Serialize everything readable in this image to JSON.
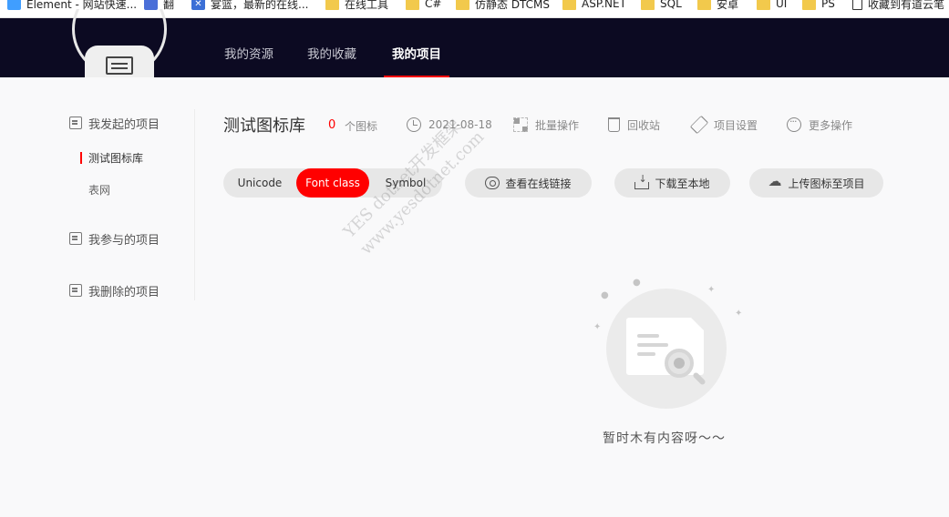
{
  "bookmarks": [
    {
      "label": "Element - 网站快速...",
      "icon": "element-icon"
    },
    {
      "label": "翻",
      "icon": "translate-icon"
    },
    {
      "label": "宴篮，最新的在线...",
      "icon": "x-icon"
    },
    {
      "label": "在线工具",
      "icon": "folder-icon"
    },
    {
      "label": "C#",
      "icon": "folder-icon"
    },
    {
      "label": "仿静态 DTCMS",
      "icon": "folder-icon"
    },
    {
      "label": "ASP.NET",
      "icon": "folder-icon"
    },
    {
      "label": "SQL",
      "icon": "folder-icon"
    },
    {
      "label": "安卓",
      "icon": "folder-icon"
    },
    {
      "label": "UI",
      "icon": "folder-icon"
    },
    {
      "label": "PS",
      "icon": "folder-icon"
    },
    {
      "label": "收藏到有道云笔",
      "icon": "page-icon"
    }
  ],
  "nav": {
    "tabs": [
      "我的资源",
      "我的收藏",
      "我的项目"
    ],
    "active": "我的项目"
  },
  "sidebar": {
    "groups": [
      {
        "label": "我发起的项目",
        "icon": "edit-doc-icon"
      },
      {
        "label": "我参与的项目",
        "icon": "search-doc-icon"
      },
      {
        "label": "我删除的项目",
        "icon": "delete-doc-icon"
      }
    ],
    "items": [
      "测试图标库",
      "表网"
    ],
    "active_item": "测试图标库"
  },
  "project": {
    "title": "测试图标库",
    "count": "0",
    "count_label": "个图标",
    "date": "2021-08-18",
    "actions": [
      "批量操作",
      "回收站",
      "项目设置",
      "更多操作"
    ]
  },
  "toolbar": {
    "segments": [
      "Unicode",
      "Font class",
      "Symbol"
    ],
    "active_segment": "Font class",
    "buttons": [
      "查看在线链接",
      "下载至本地",
      "上传图标至项目"
    ]
  },
  "empty_state": {
    "text": "暂时木有内容呀～～"
  },
  "watermark": [
    "YES dotnet开发框架",
    "www.yesdotnet.com"
  ],
  "colors": {
    "nav_bg": "#0c0a22",
    "accent": "#ff0000",
    "page_bg": "#f9f9fa"
  }
}
